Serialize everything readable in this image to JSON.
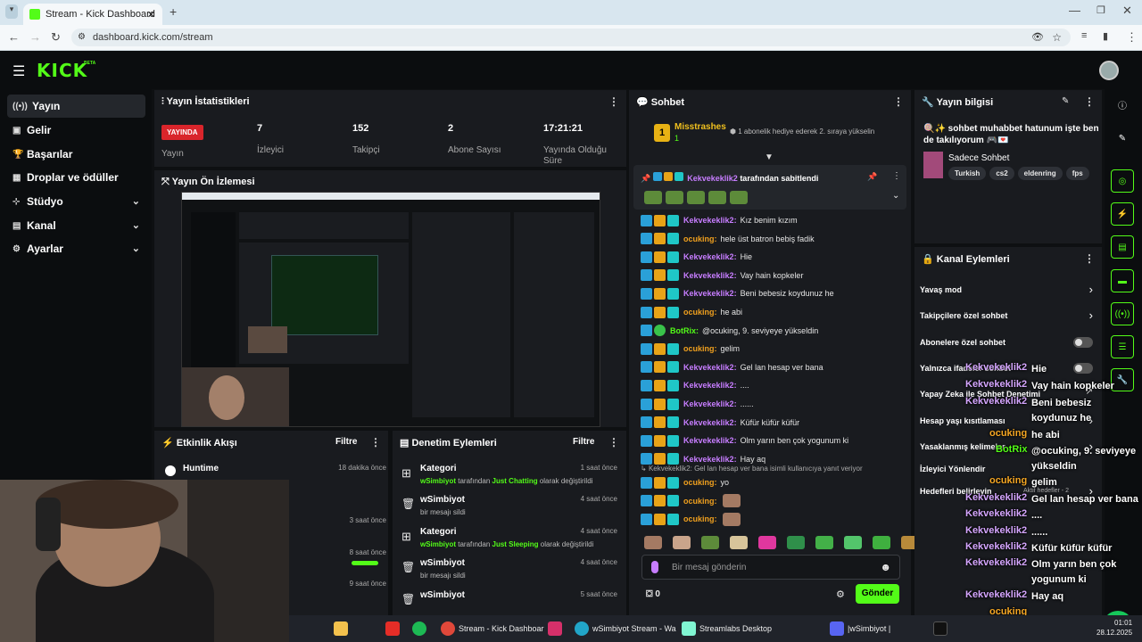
{
  "browser": {
    "tab_title": "Stream - Kick Dashboard",
    "new_tab": "+",
    "url": "dashboard.kick.com/stream"
  },
  "brand": {
    "logo": "KICK",
    "beta": "BETA",
    "accent": "#53fc18"
  },
  "sidebar": {
    "items": [
      {
        "label": "Yayın",
        "icon": "broadcast-icon"
      },
      {
        "label": "Gelir",
        "icon": "wallet-icon"
      },
      {
        "label": "Başarılar",
        "icon": "trophy-icon"
      },
      {
        "label": "Droplar ve ödüller",
        "icon": "gift-icon"
      },
      {
        "label": "Stüdyo",
        "icon": "studio-icon"
      },
      {
        "label": "Kanal",
        "icon": "channel-icon"
      },
      {
        "label": "Ayarlar",
        "icon": "gear-icon"
      }
    ]
  },
  "stats": {
    "title": "Yayın İstatistikleri",
    "live_badge": "YAYINDA",
    "status_label": "Yayın",
    "viewers": "7",
    "viewers_label": "İzleyici",
    "followers": "152",
    "followers_label": "Takipçi",
    "subs": "2",
    "subs_label": "Abone Sayısı",
    "uptime": "17:21:21",
    "uptime_label": "Yayında Olduğu Süre"
  },
  "preview": {
    "title": "Yayın Ön İzlemesi"
  },
  "activity": {
    "title": "Etkinlik Akışı",
    "filter": "Filtre",
    "items": [
      {
        "name": "Huntime",
        "time": "18 dakika önce"
      },
      {
        "name": "",
        "time": "3 saat önce"
      },
      {
        "name": "",
        "time": "8 saat önce"
      },
      {
        "name": "",
        "time": "9 saat önce"
      }
    ]
  },
  "moderation": {
    "title": "Denetim Eylemleri",
    "filter": "Filtre",
    "items": [
      {
        "title": "Kategori",
        "by": "wSimbiyot",
        "mid": " tarafından ",
        "value": "Just Chatting",
        "tail": " olarak değiştirildi",
        "time": "1 saat önce",
        "type": "category"
      },
      {
        "title": "wSimbiyot",
        "sub": "bir mesajı sildi",
        "time": "4 saat önce",
        "type": "delete"
      },
      {
        "title": "Kategori",
        "by": "wSimbiyot",
        "mid": " tarafından ",
        "value": "Just Sleeping",
        "tail": " olarak değiştirildi",
        "time": "4 saat önce",
        "type": "category"
      },
      {
        "title": "wSimbiyot",
        "sub": "bir mesajı sildi",
        "time": "4 saat önce",
        "type": "delete"
      },
      {
        "title": "wSimbiyot",
        "sub": "",
        "time": "5 saat önce",
        "type": "delete"
      }
    ]
  },
  "chat": {
    "title": "Sohbet",
    "top_gifter": "Misstrashes",
    "top_gifter_rank": "1",
    "top_gifter_count": "1",
    "gift_notice": "1 abonelik hediye ederek 2. sıraya yükselin",
    "pinned_by": "Kekvekeklik2",
    "pinned_suffix": " tarafından sabitlendi",
    "messages": [
      {
        "user": "Kekvekeklik2",
        "text": "Kız benim kızım",
        "color": "pk"
      },
      {
        "user": "ocuking",
        "text": "hele üst batron bebiş fadik",
        "color": "og"
      },
      {
        "user": "Kekvekeklik2",
        "text": "Hie",
        "color": "pk"
      },
      {
        "user": "Kekvekeklik2",
        "text": "Vay hain kopkeler",
        "color": "pk"
      },
      {
        "user": "Kekvekeklik2",
        "text": "Beni bebesiz koydunuz he",
        "color": "pk"
      },
      {
        "user": "ocuking",
        "text": "he abi",
        "color": "og"
      },
      {
        "user": "BotRix",
        "text": "@ocuking, 9. seviyeye yükseldin",
        "color": "bt"
      },
      {
        "user": "ocuking",
        "text": "gelim",
        "color": "og"
      },
      {
        "user": "Kekvekeklik2",
        "text": "Gel lan hesap ver bana",
        "color": "pk"
      },
      {
        "user": "Kekvekeklik2",
        "text": "....",
        "color": "pk"
      },
      {
        "user": "Kekvekeklik2",
        "text": "......",
        "color": "pk"
      },
      {
        "user": "Kekvekeklik2",
        "text": "Küfür küfür küfür",
        "color": "pk"
      },
      {
        "user": "Kekvekeklik2",
        "text": "Olm yarın ben çok yogunum ki",
        "color": "pk"
      },
      {
        "user": "Kekvekeklik2",
        "text": "Hay aq",
        "color": "pk"
      }
    ],
    "reply_notice": "Kekvekeklik2: Gel lan hesap ver bana isimli kullanıcıya yanıt veriyor",
    "after": [
      {
        "user": "ocuking",
        "text": "yo",
        "color": "og"
      },
      {
        "user": "ocuking",
        "text": "",
        "color": "og"
      },
      {
        "user": "ocuking",
        "text": "",
        "color": "og"
      }
    ],
    "input_placeholder": "Bir mesaj gönderin",
    "points": "0",
    "send": "Gönder"
  },
  "stream_info": {
    "title": "Yayın bilgisi",
    "stream_title": "🍭✨ sohbet muhabbet hatunum işte ben de takılıyorum 🎮💌",
    "category": "Sadece Sohbet",
    "tags": [
      "Turkish",
      "cs2",
      "eldenring",
      "fps"
    ]
  },
  "channel_actions": {
    "title": "Kanal Eylemleri",
    "items": [
      {
        "label": "Yavaş mod",
        "kind": "chev"
      },
      {
        "label": "Takipçilere özel sohbet",
        "kind": "chev"
      },
      {
        "label": "Abonelere özel sohbet",
        "kind": "toggle"
      },
      {
        "label": "Yalnızca ifadeler sohbet",
        "kind": "toggle"
      },
      {
        "label": "Yapay Zeka ile Sohbet Denetimi",
        "kind": "ext"
      },
      {
        "label": "Hesap yaşı kısıtlaması",
        "kind": "chev"
      },
      {
        "label": "Yasaklanmış kelimeler",
        "kind": "chev"
      },
      {
        "label": "İzleyici Yönlendir",
        "kind": "none"
      },
      {
        "label": "Hedefleri belirleyin",
        "kind": "chev",
        "note": "Aktif hedefler - 2"
      }
    ]
  },
  "overlay_chat": [
    {
      "user": "Kekvekeklik2",
      "text": "Hie"
    },
    {
      "user": "Kekvekeklik2",
      "text": "Vay hain kopkeler"
    },
    {
      "user": "Kekvekeklik2",
      "text": "Beni bebesiz koydunuz he"
    },
    {
      "user": "ocuking",
      "text": "he abi"
    },
    {
      "user": "BotRix",
      "text": "@ocuking, 9. seviyeye yükseldin"
    },
    {
      "user": "ocuking",
      "text": "gelim"
    },
    {
      "user": "Kekvekeklik2",
      "text": "Gel lan hesap ver bana"
    },
    {
      "user": "Kekvekeklik2",
      "text": "...."
    },
    {
      "user": "Kekvekeklik2",
      "text": "......"
    },
    {
      "user": "Kekvekeklik2",
      "text": "Küfür küfür küfür"
    },
    {
      "user": "Kekvekeklik2",
      "text": "Olm yarın ben çok yogunum ki"
    },
    {
      "user": "Kekvekeklik2",
      "text": "Hay aq"
    },
    {
      "user": "ocuking",
      "text": ""
    },
    {
      "user": "ocuking",
      "text": ""
    }
  ],
  "taskbar": {
    "apps": [
      "Stream - Kick Dashboar",
      "wSimbiyot Stream - Wa",
      "Streamlabs Desktop",
      "|wSimbiyot |"
    ],
    "time": "01:01",
    "date": "28.12.2025"
  }
}
